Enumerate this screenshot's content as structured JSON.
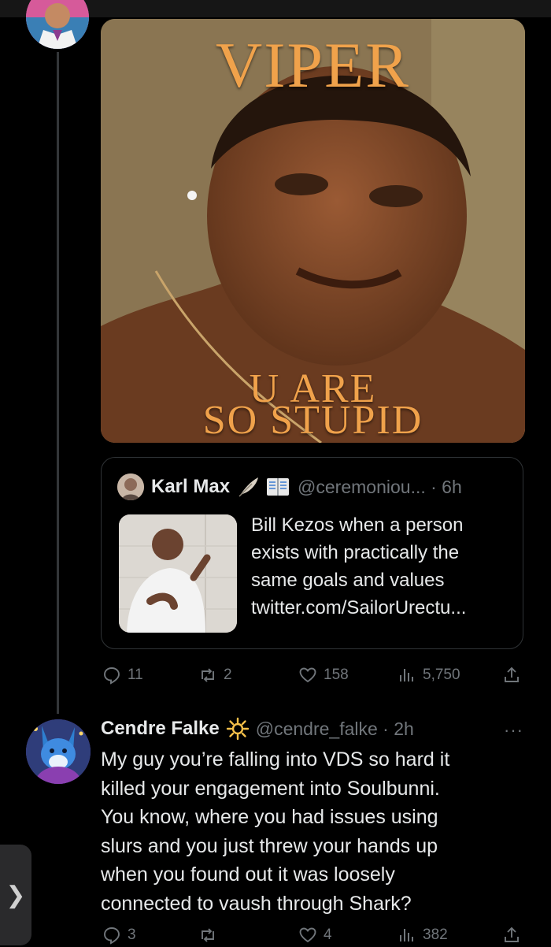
{
  "first_tweet": {
    "image_text": {
      "top": "VIPER",
      "bottom_line1": "U ARE",
      "bottom_line2": "SO STUPID"
    },
    "quote": {
      "author_name": "Karl Max",
      "handle_time": "@ceremoniou... · 6h",
      "text_lines": [
        "Bill Kezos when a person",
        "exists with practically the",
        "same goals and values",
        "twitter.com/SailorUrectu..."
      ]
    },
    "actions": {
      "replies": "11",
      "reposts": "2",
      "likes": "158",
      "views": "5,750"
    }
  },
  "reply_tweet": {
    "author_name": "Cendre Falke",
    "handle_time": "@cendre_falke · 2h",
    "more": "···",
    "text_lines": [
      "My guy you’re falling into VDS so hard it",
      "killed your engagement into Soulbunni.",
      "You know, where you had issues using",
      "slurs and you just threw your hands up",
      "when you found out it was loosely",
      "connected to vaush through Shark?"
    ],
    "actions": {
      "replies": "3",
      "reposts": "",
      "likes": "4",
      "views": "382"
    }
  },
  "side_tab_glyph": "❯",
  "icons": {
    "reply": "reply-icon",
    "repost": "repost-icon",
    "like": "like-icon",
    "views": "views-icon",
    "share": "share-icon",
    "quill": "quill-icon",
    "book": "book-icon",
    "sun": "sun-icon"
  },
  "colors": {
    "background": "#000000",
    "text": "#e7e9ea",
    "secondary_text": "#71767b",
    "border": "#2f3336",
    "meme_text": "#f0a24b"
  }
}
